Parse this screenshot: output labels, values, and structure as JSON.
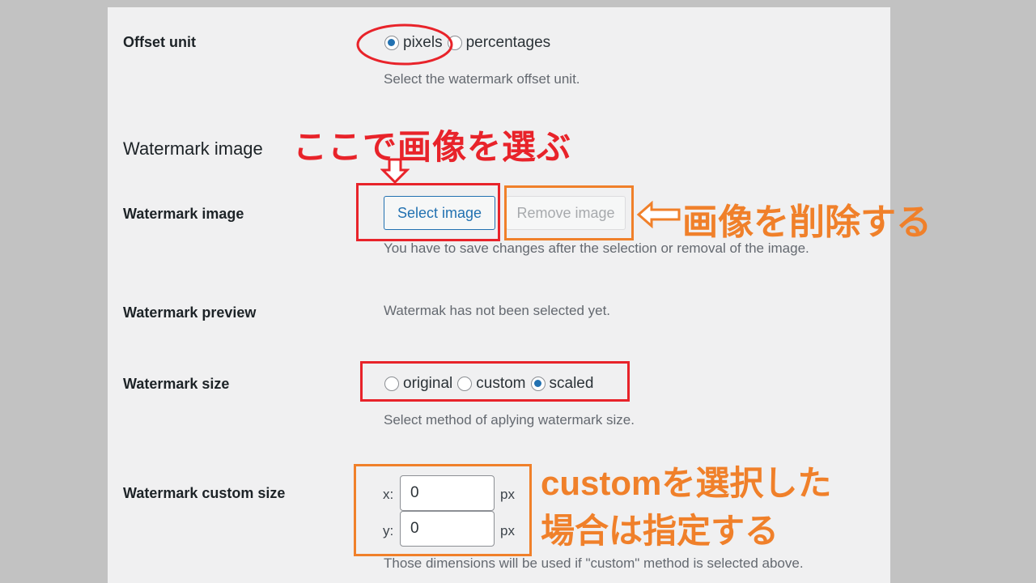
{
  "offset_unit": {
    "label": "Offset unit",
    "options": [
      "pixels",
      "percentages"
    ],
    "selected": "pixels",
    "description": "Select the watermark offset unit."
  },
  "watermark_image_section": {
    "heading": "Watermark image"
  },
  "watermark_image": {
    "label": "Watermark image",
    "select_button": "Select image",
    "remove_button": "Remove image",
    "description": "You have to save changes after the selection or removal of the image."
  },
  "watermark_preview": {
    "label": "Watermark preview",
    "text": "Watermak has not been selected yet."
  },
  "watermark_size": {
    "label": "Watermark size",
    "options": [
      "original",
      "custom",
      "scaled"
    ],
    "selected": "scaled",
    "description": "Select method of aplying watermark size."
  },
  "watermark_custom_size": {
    "label": "Watermark custom size",
    "x_label": "x:",
    "y_label": "y:",
    "x_value": "0",
    "y_value": "0",
    "unit": "px",
    "description": "Those dimensions will be used if \"custom\" method is selected above."
  },
  "annotations": {
    "select_here": "ここで画像を選ぶ",
    "delete_image": "画像を削除する",
    "custom_line1": "customを選択した",
    "custom_line2": "場合は指定する"
  },
  "colors": {
    "annotation_red": "#e8232a",
    "annotation_orange": "#f0802a",
    "accent": "#2271b1"
  }
}
